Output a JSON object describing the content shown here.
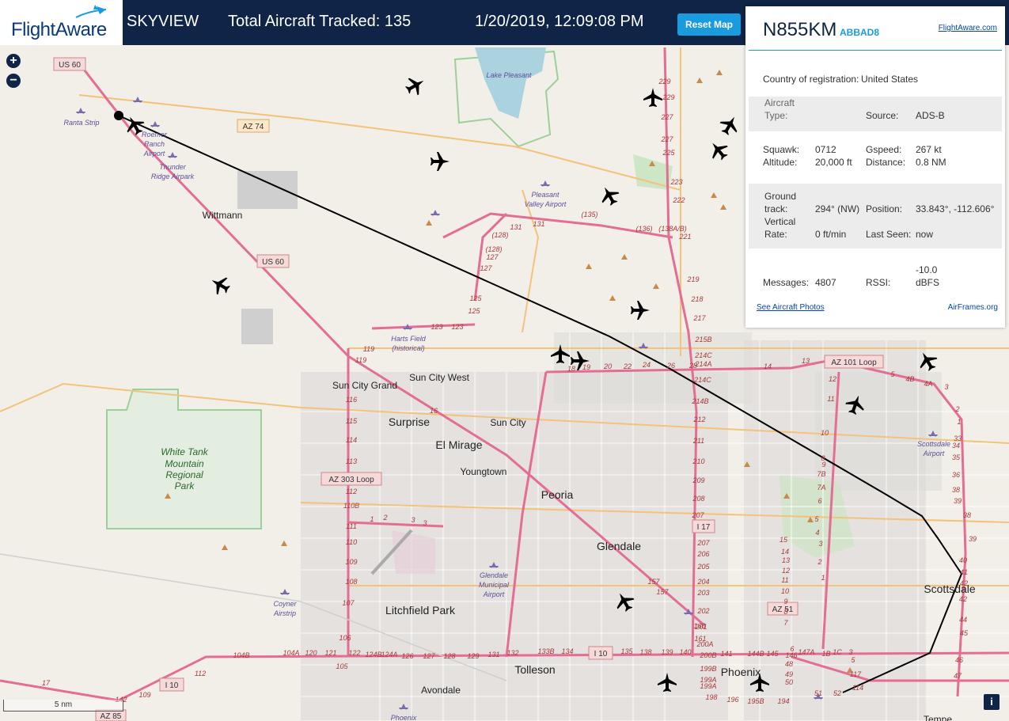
{
  "header": {
    "logo_text": "FlightAware",
    "brand": "SKYVIEW",
    "tracked": "Total Aircraft Tracked: 135",
    "datetime": "1/20/2019, 12:09:08 PM",
    "reset_label": "Reset Map"
  },
  "map": {
    "zoom_in": "+",
    "zoom_out": "−",
    "scale_label": "5 nm",
    "info_label": "i",
    "cities": [
      "Wittmann",
      "Sun City Grand",
      "Sun City West",
      "Surprise",
      "Sun City",
      "El Mirage",
      "Youngtown",
      "Peoria",
      "Glendale",
      "Litchfield Park",
      "Tolleson",
      "Avondale",
      "Phoenix",
      "Scottsdale",
      "Tempe"
    ],
    "parks": [
      "White Tank",
      "Mountain",
      "Regional",
      "Park"
    ],
    "airports": [
      "Ranta Strip",
      "Roemer",
      "Ranch",
      "Airport",
      "Thunder",
      "Ridge Airpark",
      "Pleasant",
      "Valley Airport",
      "Harts Field",
      "(historical)",
      "Glendale",
      "Municipal",
      "Airport",
      "Coyner",
      "Airstrip",
      "Scottsdale",
      "Airport",
      "Phoenix",
      "Lake Pleasant"
    ],
    "highways": [
      "US 60",
      "AZ 74",
      "US 60",
      "AZ 303 Loop",
      "AZ 101 Loop",
      "I 17",
      "AZ 51",
      "I 10",
      "I 10",
      "AZ 85"
    ],
    "route_numbers": [
      "229",
      "229",
      "227",
      "227",
      "225",
      "223",
      "222",
      "221",
      "219",
      "218",
      "217",
      "215B",
      "214C",
      "214A",
      "214C",
      "214B",
      "212",
      "211",
      "210",
      "209",
      "208",
      "207",
      "207",
      "206",
      "205",
      "204",
      "203",
      "202",
      "201",
      "200A",
      "200B",
      "199B",
      "199A",
      "199A",
      "198",
      "196",
      "195B",
      "194",
      "131",
      "131",
      "(135)",
      "(136)",
      "(138A/B)",
      "(128)",
      "(128)",
      "127",
      "127",
      "125",
      "125",
      "123",
      "123",
      "119",
      "119",
      "116",
      "115",
      "114",
      "113",
      "112",
      "110B",
      "111",
      "110",
      "109",
      "108",
      "107",
      "106",
      "105",
      "104B",
      "104A",
      "120",
      "121",
      "122",
      "124B",
      "124A",
      "126",
      "127",
      "128",
      "129",
      "131",
      "132",
      "133B",
      "134",
      "135",
      "138",
      "139",
      "140",
      "141",
      "144B",
      "145",
      "146",
      "147A",
      "1B",
      "1C",
      "3",
      "5",
      "117",
      "114",
      "112",
      "109",
      "142",
      "17",
      "16",
      "18",
      "19",
      "20",
      "22",
      "24",
      "26",
      "28",
      "14",
      "13",
      "12",
      "11",
      "10",
      "9",
      "8",
      "7B",
      "7A",
      "6",
      "5",
      "4",
      "3",
      "2",
      "1",
      "157",
      "157",
      "160",
      "161",
      "1",
      "2",
      "3",
      "3",
      "15",
      "14",
      "13",
      "12",
      "11",
      "10",
      "9",
      "8",
      "7",
      "6",
      "5",
      "4B",
      "4A",
      "3",
      "2",
      "1",
      "33",
      "34",
      "35",
      "36",
      "38",
      "39",
      "38",
      "39",
      "40",
      "41",
      "42",
      "42",
      "44",
      "45",
      "46",
      "47",
      "48",
      "49",
      "50",
      "51",
      "52",
      "149",
      "150",
      "152",
      "153",
      "154"
    ]
  },
  "panel": {
    "registration": "N855KM",
    "hex": "ABBAD8",
    "fa_link": "FlightAware.com",
    "country_label": "Country of registration:",
    "country_value": "United States",
    "aircraft_type_label": "Aircraft Type:",
    "aircraft_type_value": "",
    "source_label": "Source:",
    "source_value": "ADS-B",
    "squawk_label": "Squawk:",
    "squawk_value": "0712",
    "altitude_label": "Altitude:",
    "altitude_value": "20,000 ft",
    "gspeed_label": "Gspeed:",
    "gspeed_value": "267 kt",
    "distance_label": "Distance:",
    "distance_value": "0.8 NM",
    "ground_track_label": "Ground track:",
    "ground_track_value": "294° (NW)",
    "position_label": "Position:",
    "position_value": "33.843°, -112.606°",
    "vrate_label": "Vertical Rate:",
    "vrate_value": "0 ft/min",
    "last_seen_label": "Last Seen:",
    "last_seen_value": "now",
    "messages_label": "Messages:",
    "messages_value": "4807",
    "rssi_label": "RSSI:",
    "rssi_value": "-10.0 dBFS",
    "photos_link": "See Aircraft Photos",
    "airframes_link": "AirFrames.org"
  },
  "colors": {
    "header_bg": "#0f2446",
    "accent": "#1a9be0",
    "track": "#000000",
    "highway": "#e46d93",
    "road": "#f5c27a"
  }
}
